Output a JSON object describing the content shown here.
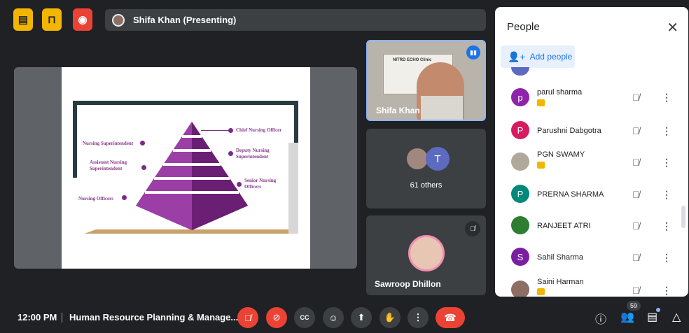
{
  "topbar": {
    "presenter_label": "Shifa Khan (Presenting)"
  },
  "slide": {
    "levels": [
      "Chief Nursing Officer",
      "Nursing Superintendent",
      "Deputy Nursing Superintendent",
      "Assistant Nursing Superintendent",
      "Senior Nursing Officers",
      "Nursing Officers"
    ]
  },
  "tiles": {
    "presenter_name": "Shifa Khan",
    "presenter_sign": "NITRD ECHO Clinic",
    "others_label": "61 others",
    "others_initial": "T",
    "third_name": "Sawroop Dhillon"
  },
  "people_panel": {
    "title": "People",
    "add_people": "Add people",
    "participants": [
      {
        "initial": "p",
        "name": "parul sharma",
        "color": "#8e24aa",
        "presenting_badge": true
      },
      {
        "initial": "P",
        "name": "Parushni Dabgotra",
        "color": "#d81b60",
        "presenting_badge": false
      },
      {
        "initial": "",
        "name": "PGN SWAMY",
        "color": "#b0a89a",
        "presenting_badge": true
      },
      {
        "initial": "P",
        "name": "PRERNA SHARMA",
        "color": "#00897b",
        "presenting_badge": false
      },
      {
        "initial": "",
        "name": "RANJEET ATRI",
        "color": "#2e7d32",
        "presenting_badge": false
      },
      {
        "initial": "S",
        "name": "Sahil Sharma",
        "color": "#7b1fa2",
        "presenting_badge": false
      },
      {
        "initial": "",
        "name": "Saini Harman",
        "color": "#8d6e63",
        "presenting_badge": true
      }
    ]
  },
  "bottombar": {
    "time": "12:00 PM",
    "meeting_title": "Human Resource Planning & Manage...",
    "participant_count": "59"
  },
  "colors": {
    "accent_blue": "#1a73e8",
    "alert_red": "#ea4335",
    "badge_yellow": "#f2b600",
    "slide_purple": "#7b2c86"
  }
}
